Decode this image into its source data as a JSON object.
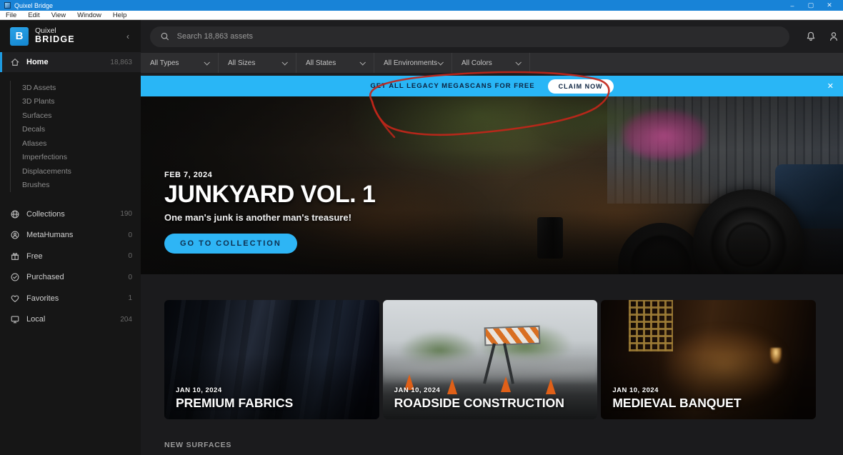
{
  "window": {
    "title": "Quixel Bridge",
    "menu": [
      "File",
      "Edit",
      "View",
      "Window",
      "Help"
    ],
    "controls": {
      "minimize": "–",
      "maximize": "▢",
      "close": "✕"
    }
  },
  "sidebar": {
    "logo_letter": "B",
    "logo_top": "Quixel",
    "logo_bottom": "BRIDGE",
    "collapse_icon": "‹",
    "home": {
      "label": "Home",
      "count": "18,863"
    },
    "categories": [
      "3D Assets",
      "3D Plants",
      "Surfaces",
      "Decals",
      "Atlases",
      "Imperfections",
      "Displacements",
      "Brushes"
    ],
    "library": [
      {
        "label": "Collections",
        "count": "190"
      },
      {
        "label": "MetaHumans",
        "count": "0"
      },
      {
        "label": "Free",
        "count": "0"
      },
      {
        "label": "Purchased",
        "count": "0"
      },
      {
        "label": "Favorites",
        "count": "1"
      },
      {
        "label": "Local",
        "count": "204"
      }
    ]
  },
  "topbar": {
    "search_placeholder": "Search 18,863 assets"
  },
  "filters": [
    "All Types",
    "All Sizes",
    "All States",
    "All Environments",
    "All Colors"
  ],
  "banner": {
    "message": "GET ALL LEGACY MEGASCANS FOR FREE",
    "cta": "CLAIM NOW",
    "close": "✕",
    "background": "#29b6f6"
  },
  "hero": {
    "date": "FEB 7, 2024",
    "title": "JUNKYARD VOL. 1",
    "subtitle": "One man's junk is another man's treasure!",
    "cta": "GO TO COLLECTION"
  },
  "cards": [
    {
      "date": "JAN 10, 2024",
      "title": "PREMIUM FABRICS"
    },
    {
      "date": "JAN 10, 2024",
      "title": "ROADSIDE CONSTRUCTION"
    },
    {
      "date": "JAN 10, 2024",
      "title": "MEDIEVAL BANQUET"
    }
  ],
  "section_heading": "NEW SURFACES",
  "colors": {
    "accent_blue": "#29b6f6",
    "titlebar_blue": "#1883d7",
    "annotation_red": "#c1261a"
  }
}
